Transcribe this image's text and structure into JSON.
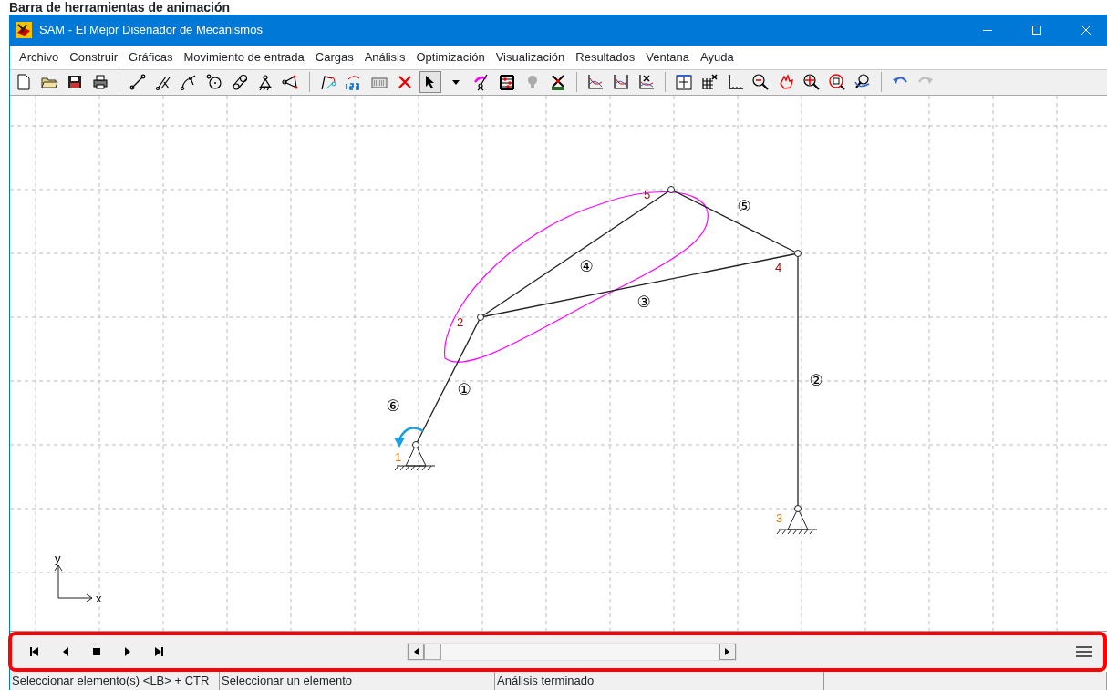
{
  "caption": "Barra de herramientas de animación",
  "window": {
    "title": "SAM - El Mejor Diseñador de Mecanismos"
  },
  "menu": [
    "Archivo",
    "Construir",
    "Gráficas",
    "Movimiento de entrada",
    "Cargas",
    "Análisis",
    "Optimización",
    "Visualización",
    "Resultados",
    "Ventana",
    "Ayuda"
  ],
  "diagram": {
    "joints": [
      {
        "label": "1",
        "kind": "ground"
      },
      {
        "label": "2",
        "kind": "pin"
      },
      {
        "label": "3",
        "kind": "ground"
      },
      {
        "label": "4",
        "kind": "pin"
      },
      {
        "label": "5",
        "kind": "pin"
      }
    ],
    "links": [
      {
        "label": "①"
      },
      {
        "label": "②"
      },
      {
        "label": "③"
      },
      {
        "label": "④"
      },
      {
        "label": "⑤"
      },
      {
        "label": "⑥"
      }
    ],
    "axes": {
      "x": "x",
      "y": "y"
    }
  },
  "status_bar": [
    "Seleccionar elemento(s) <LB> + CTR",
    "Seleccionar un elemento",
    "Análisis terminado"
  ]
}
